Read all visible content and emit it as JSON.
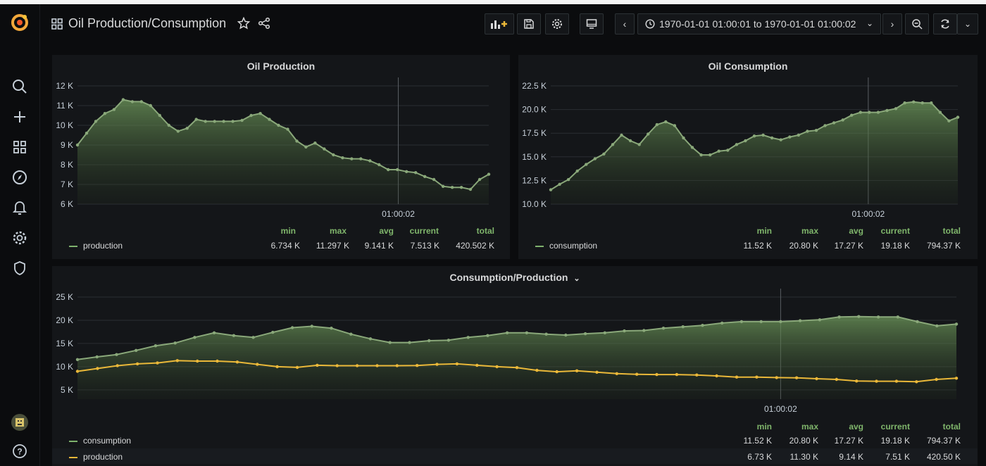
{
  "colors": {
    "green": "#7eb26d",
    "yellow": "#eab839",
    "grid": "#2a2d32",
    "axis": "#c7d0d9",
    "cursor": "#5a5e63"
  },
  "header": {
    "title": "Oil Production/Consumption",
    "time_range": "1970-01-01 01:00:01 to 1970-01-01 01:00:02"
  },
  "sidebar": {
    "icons": [
      "grafana-logo-icon",
      "search-icon",
      "plus-icon",
      "dashboards-icon",
      "explore-icon",
      "alerting-icon",
      "configuration-icon",
      "shield-icon",
      "user-avatar",
      "help-icon"
    ]
  },
  "legend_headers": [
    "min",
    "max",
    "avg",
    "current",
    "total"
  ],
  "panels": {
    "production": {
      "title": "Oil Production",
      "cursor_label": "01:00:02",
      "legend": [
        {
          "name": "production",
          "min": "6.734 K",
          "max": "11.297 K",
          "avg": "9.141 K",
          "current": "7.513 K",
          "total": "420.502 K"
        }
      ]
    },
    "consumption": {
      "title": "Oil Consumption",
      "cursor_label": "01:00:02",
      "legend": [
        {
          "name": "consumption",
          "min": "11.52 K",
          "max": "20.80 K",
          "avg": "17.27 K",
          "current": "19.18 K",
          "total": "794.37 K"
        }
      ]
    },
    "combined": {
      "title": "Consumption/Production",
      "cursor_label": "01:00:02",
      "legend": [
        {
          "name": "consumption",
          "min": "11.52 K",
          "max": "20.80 K",
          "avg": "17.27 K",
          "current": "19.18 K",
          "total": "794.37 K"
        },
        {
          "name": "production",
          "min": "6.73 K",
          "max": "11.30 K",
          "avg": "9.14 K",
          "current": "7.51 K",
          "total": "420.50 K"
        }
      ]
    }
  },
  "chart_data": [
    {
      "type": "line",
      "title": "Oil Production",
      "yticks": [
        "6 K",
        "7 K",
        "8 K",
        "9 K",
        "10 K",
        "11 K",
        "12 K"
      ],
      "ylim": [
        6000,
        12000
      ],
      "x_label_at_cursor": "01:00:02",
      "series": [
        {
          "name": "production",
          "values": [
            9000,
            9600,
            10200,
            10600,
            10800,
            11300,
            11200,
            11200,
            11000,
            10500,
            10000,
            9700,
            9850,
            10300,
            10200,
            10200,
            10200,
            10200,
            10250,
            10500,
            10600,
            10300,
            10000,
            9800,
            9200,
            8900,
            9100,
            8800,
            8500,
            8350,
            8300,
            8300,
            8200,
            8000,
            7750,
            7750,
            7650,
            7600,
            7400,
            7250,
            6900,
            6850,
            6850,
            6750,
            7250,
            7513
          ]
        }
      ]
    },
    {
      "type": "line",
      "title": "Oil Consumption",
      "yticks": [
        "10.0 K",
        "12.5 K",
        "15.0 K",
        "17.5 K",
        "20.0 K",
        "22.5 K"
      ],
      "ylim": [
        10000,
        22500
      ],
      "x_label_at_cursor": "01:00:02",
      "series": [
        {
          "name": "consumption",
          "values": [
            11520,
            12100,
            12600,
            13500,
            14200,
            14800,
            15300,
            16300,
            17300,
            16700,
            16300,
            17400,
            18400,
            18700,
            18300,
            17000,
            16000,
            15200,
            15200,
            15600,
            15700,
            16300,
            16700,
            17200,
            17300,
            17000,
            16800,
            17100,
            17300,
            17700,
            17800,
            18300,
            18600,
            18900,
            19400,
            19700,
            19700,
            19700,
            19900,
            20100,
            20700,
            20800,
            20700,
            20700,
            19700,
            18800,
            19180
          ]
        }
      ]
    },
    {
      "type": "line",
      "title": "Consumption/Production",
      "yticks": [
        "5 K",
        "10 K",
        "15 K",
        "20 K",
        "25 K"
      ],
      "ylim": [
        3000,
        25000
      ],
      "x_label_at_cursor": "01:00:02",
      "series": [
        {
          "name": "consumption",
          "values": [
            11520,
            12100,
            12600,
            13500,
            14500,
            15100,
            16300,
            17300,
            16700,
            16300,
            17400,
            18400,
            18700,
            18300,
            17000,
            16000,
            15200,
            15200,
            15600,
            15700,
            16300,
            16700,
            17300,
            17300,
            17000,
            16800,
            17100,
            17300,
            17700,
            17800,
            18300,
            18600,
            18900,
            19400,
            19700,
            19700,
            19700,
            19900,
            20100,
            20700,
            20800,
            20700,
            20700,
            19700,
            18800,
            19180
          ]
        },
        {
          "name": "production",
          "values": [
            9000,
            9600,
            10200,
            10600,
            10800,
            11300,
            11200,
            11200,
            11000,
            10500,
            10000,
            9850,
            10300,
            10200,
            10200,
            10200,
            10200,
            10250,
            10500,
            10600,
            10300,
            10000,
            9800,
            9200,
            8900,
            9100,
            8800,
            8500,
            8350,
            8300,
            8300,
            8200,
            8000,
            7750,
            7750,
            7650,
            7600,
            7400,
            7250,
            6900,
            6850,
            6850,
            6750,
            7250,
            7513
          ]
        }
      ]
    }
  ]
}
